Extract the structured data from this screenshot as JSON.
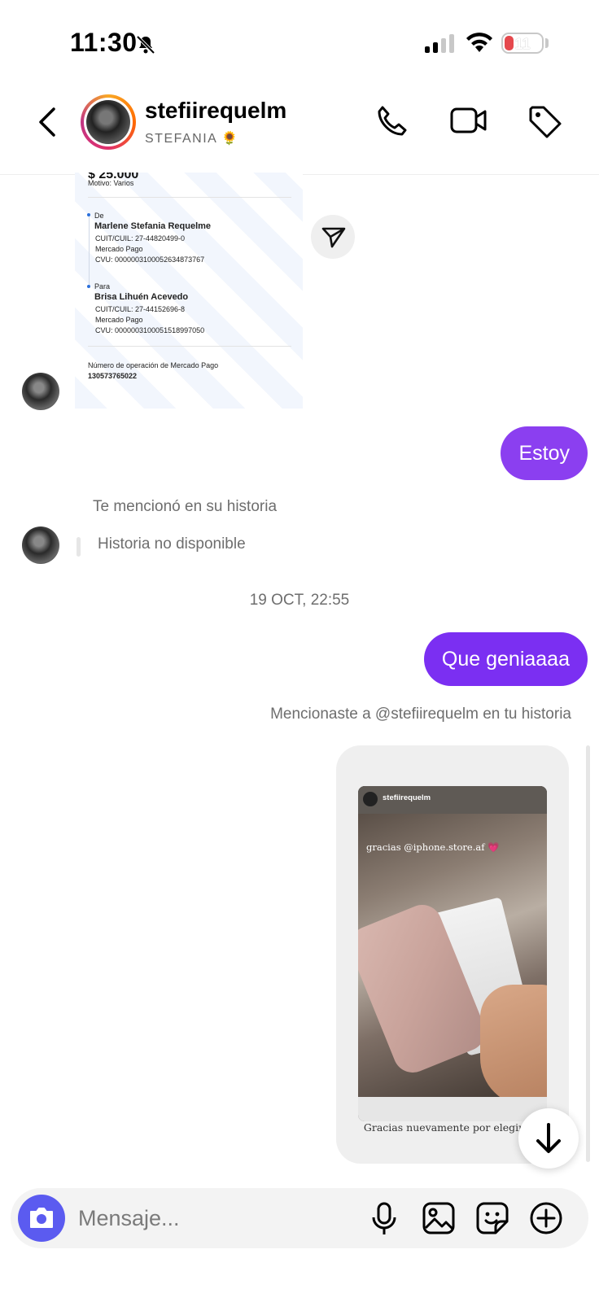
{
  "status_bar": {
    "time": "11:30",
    "battery": "11"
  },
  "header": {
    "username": "stefiirequelm",
    "display_name": "STEFANIA 🌻"
  },
  "receipt": {
    "reason": "Motivo: Varios",
    "from_label": "De",
    "from_name": "Marlene Stefania Requelme",
    "from_cuit": "CUIT/CUIL: 27-44820499-0",
    "from_bank": "Mercado Pago",
    "from_cvu": "CVU: 0000003100052634873767",
    "to_label": "Para",
    "to_name": "Brisa Lihuén Acevedo",
    "to_cuit": "CUIT/CUIL: 27-44152696-8",
    "to_bank": "Mercado Pago",
    "to_cvu": "CVU: 0000003100051518997050",
    "op_label": "Número de operación de Mercado Pago",
    "op_number": "130573765022"
  },
  "messages": {
    "sent_1": "Estoy",
    "mention_received": "Te mencionó en su historia",
    "story_unavailable": "Historia no disponible",
    "date_separator": "19 OCT, 22:55",
    "sent_2": "Que geniaaaa",
    "mention_sent": "Mencionaste a @stefiirequelm en tu historia"
  },
  "story": {
    "username": "stefiirequelm",
    "overlay_text": "gracias @iphone.store.af 💗",
    "caption": "Gracias nuevamente por elegirnos"
  },
  "composer": {
    "placeholder": "Mensaje..."
  },
  "colors": {
    "bubble_1": "#8b3ff0",
    "bubble_2": "#7b2ff2",
    "camera_button": "#5b5bf0"
  }
}
